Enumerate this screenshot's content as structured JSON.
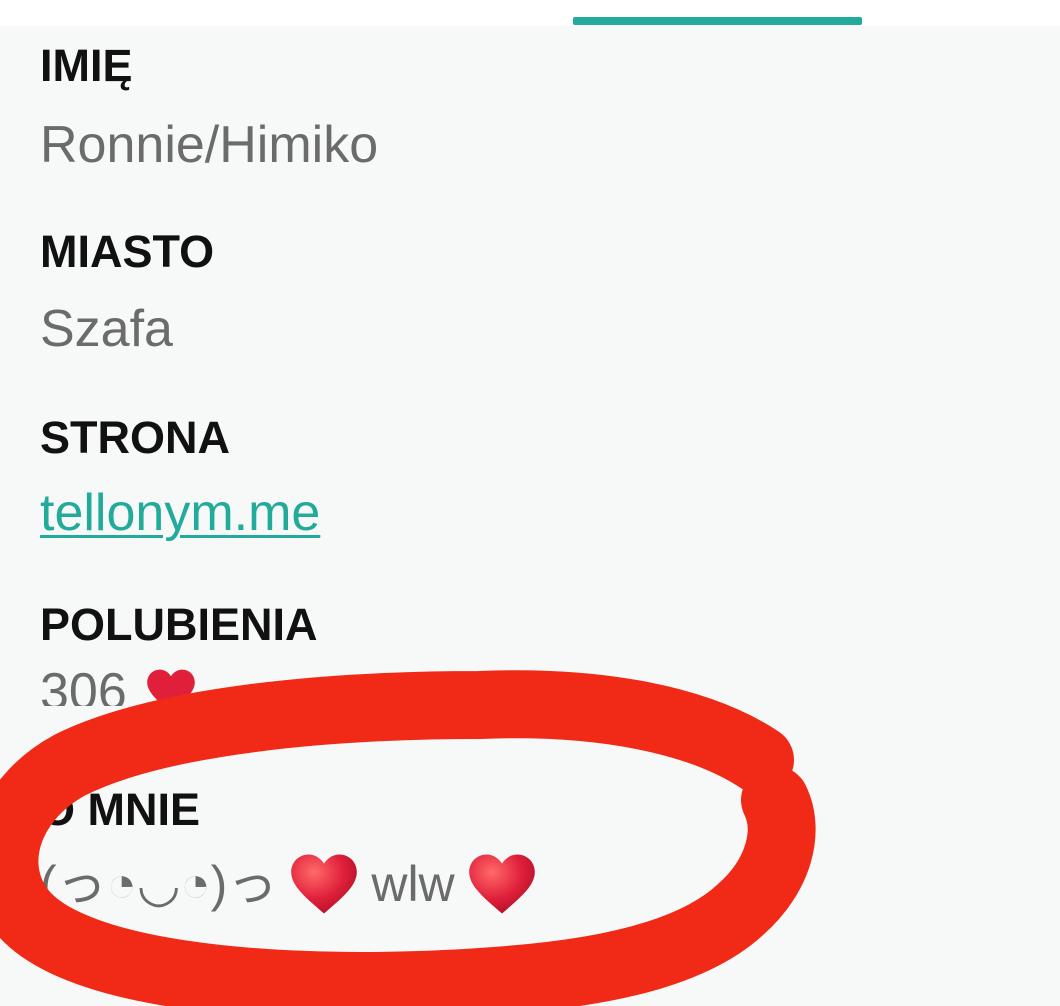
{
  "colors": {
    "accent": "#22ab9a",
    "label": "#111111",
    "value": "#6b6b6b",
    "heart": "#e0203a",
    "markup": "#f02a17"
  },
  "fields": {
    "name": {
      "label": "IMIĘ",
      "value": "Ronnie/Himiko"
    },
    "city": {
      "label": "MIASTO",
      "value": "Szafa"
    },
    "website": {
      "label": "STRONA",
      "value": "tellonym.me"
    },
    "likes": {
      "label": "POLUBIENIA",
      "value": "306",
      "icon": "heart-icon"
    },
    "about": {
      "label": "O MNIE",
      "kaomoji": "(っ◔◡◔)っ",
      "word": "wlw",
      "icons": [
        "heart-icon",
        "heart-icon"
      ]
    }
  }
}
